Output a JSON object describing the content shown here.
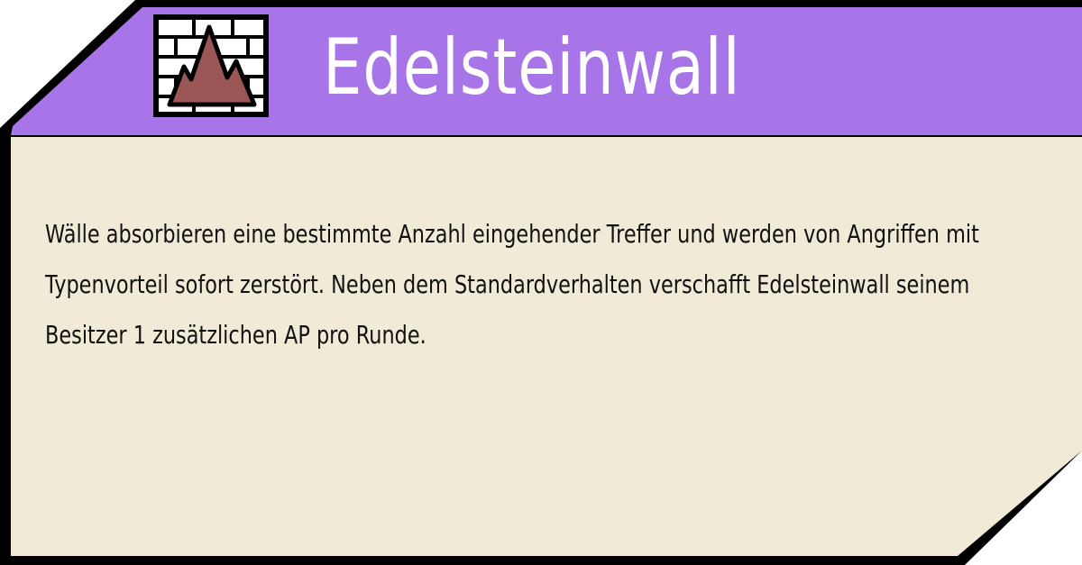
{
  "card": {
    "title": "Edelsteinwall",
    "description": "Wälle absorbieren eine bestimmte Anzahl eingehender Treffer und werden von Angriffen mit Typenvorteil sofort zerstört. Neben dem Standardverhalten verschafft Edelsteinwall seinem Besitzer 1 zusätzlichen AP pro Runde.",
    "icon": "wall-mountain-icon"
  },
  "colors": {
    "header": "#a875e8",
    "body": "#f1ead6",
    "border": "#000000",
    "title_text": "#ffffff",
    "body_text": "#111111",
    "icon_fill": "#9b5656"
  }
}
